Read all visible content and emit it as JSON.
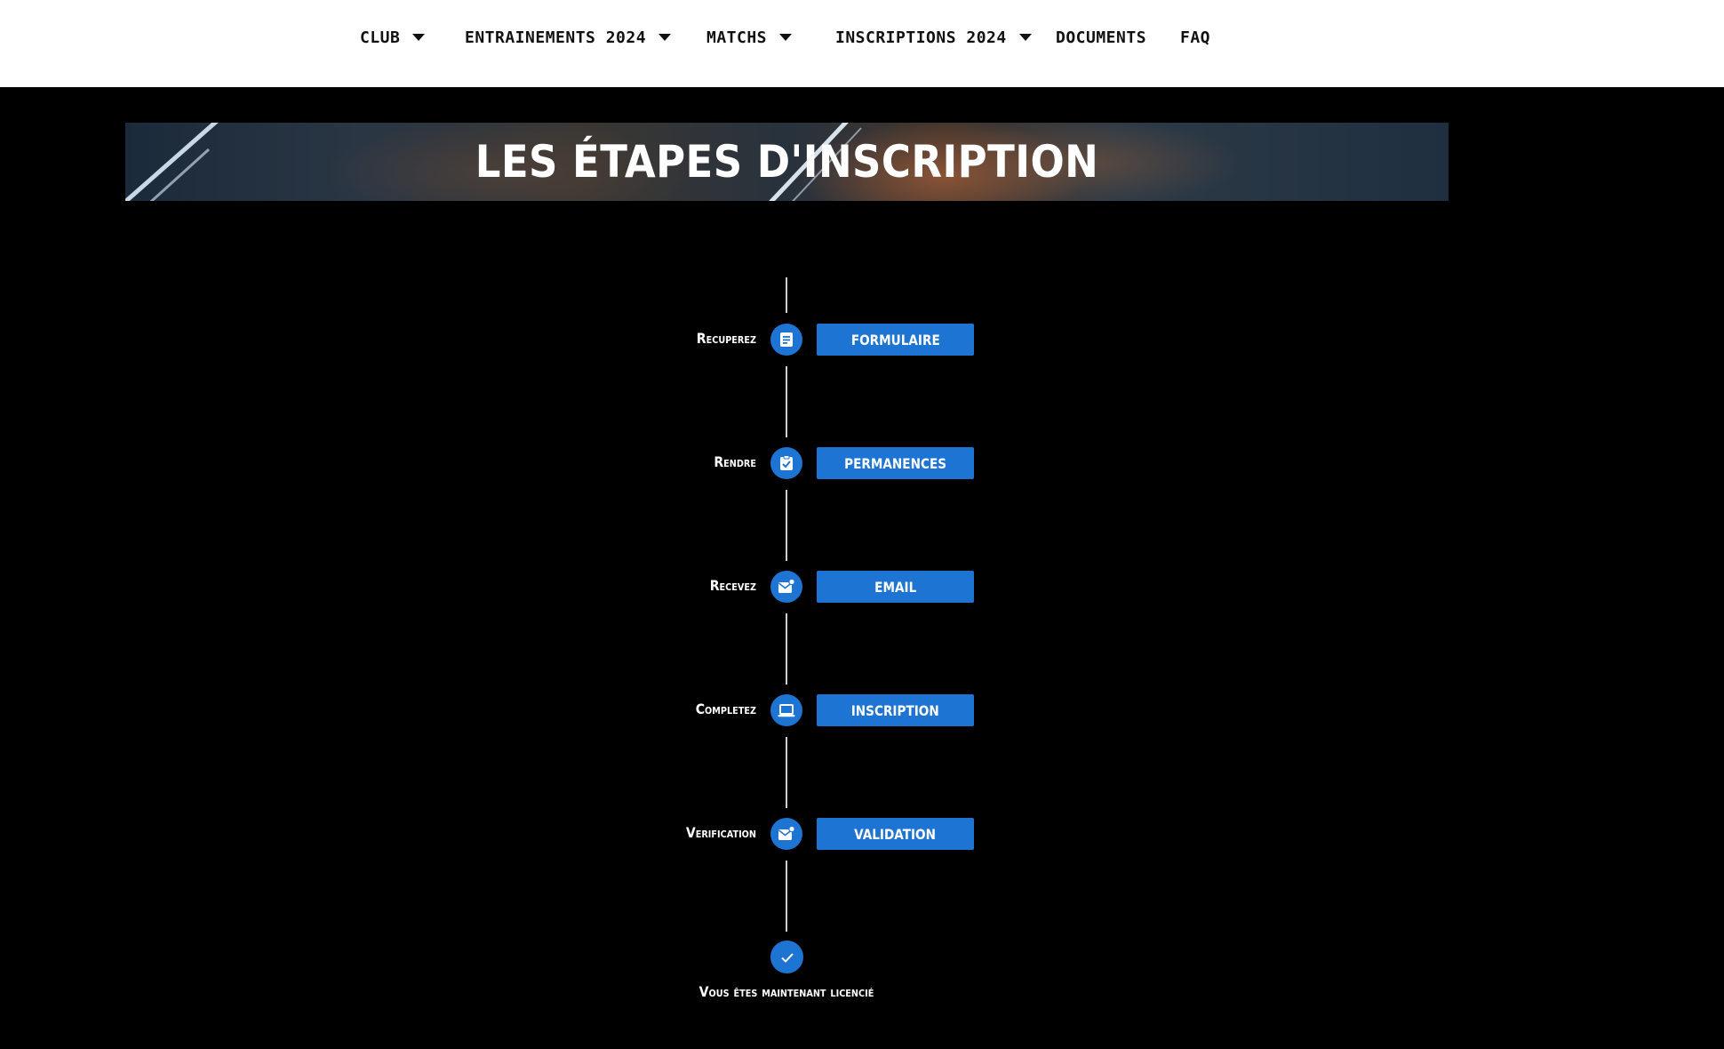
{
  "nav": {
    "items": [
      {
        "label": "CLUB",
        "dropdown": true
      },
      {
        "label": "ENTRAINEMENTS 2024",
        "dropdown": true
      },
      {
        "label": "MATCHS",
        "dropdown": true
      },
      {
        "label": "INSCRIPTIONS 2024",
        "dropdown": true
      },
      {
        "label": "DOCUMENTS",
        "dropdown": false
      },
      {
        "label": "FAQ",
        "dropdown": false
      }
    ]
  },
  "banner": {
    "title": "LES ÉTAPES D'INSCRIPTION"
  },
  "steps": [
    {
      "label": "Recuperez",
      "icon": "document-icon",
      "button": "FORMULAIRE"
    },
    {
      "label": "Rendre",
      "icon": "clipboard-check-icon",
      "button": "PERMANENCES"
    },
    {
      "label": "Recevez",
      "icon": "mail-notification-icon",
      "button": "EMAIL"
    },
    {
      "label": "Completez",
      "icon": "laptop-icon",
      "button": "INSCRIPTION"
    },
    {
      "label": "Verification",
      "icon": "mail-notification-icon",
      "button": "VALIDATION"
    }
  ],
  "final": {
    "icon": "checkmark-icon",
    "text": "Vous êtes maintenant licencié"
  },
  "colors": {
    "accent": "#1e74d2",
    "background": "#000000",
    "nav_background": "#ffffff",
    "timeline_line": "#cfcfcf"
  }
}
